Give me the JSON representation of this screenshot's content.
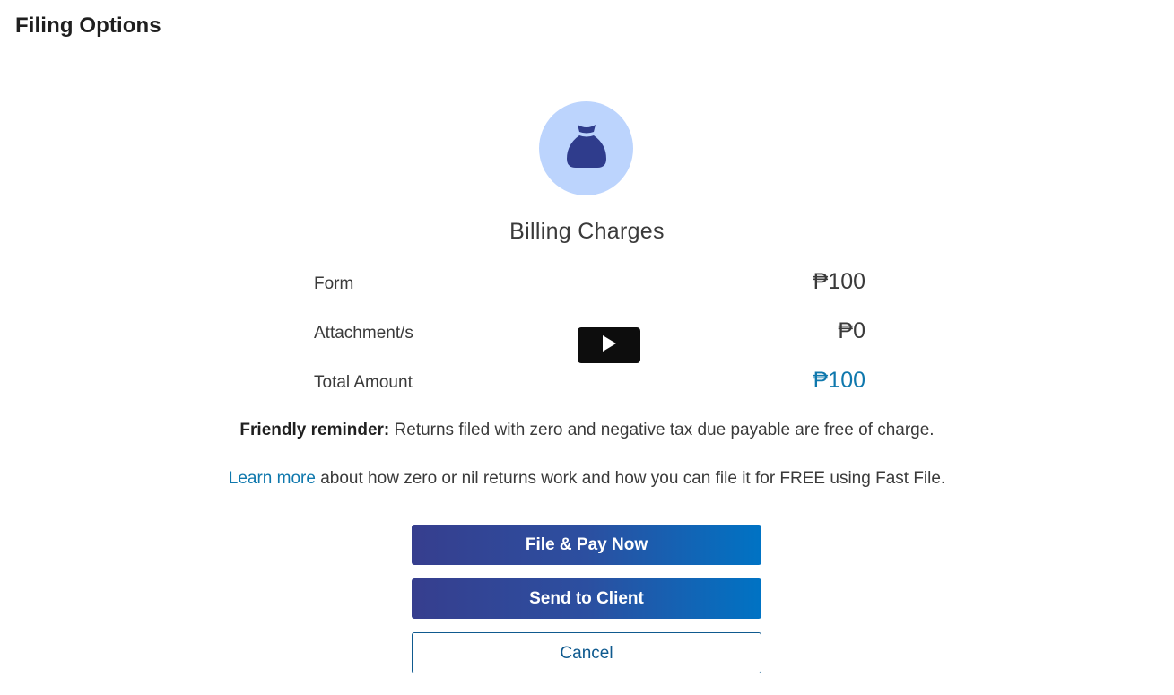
{
  "page": {
    "title": "Filing Options"
  },
  "billing": {
    "icon": "money-bag-icon",
    "title": "Billing Charges",
    "rows": [
      {
        "label": "Form",
        "value": "₱100"
      },
      {
        "label": "Attachment/s",
        "value": "₱0"
      },
      {
        "label": "Total Amount",
        "value": "₱100"
      }
    ]
  },
  "reminder": {
    "bold": "Friendly reminder:",
    "text": " Returns filed with zero and negative tax due payable are free of charge."
  },
  "learn_more": {
    "link": "Learn more",
    "text": " about how zero or nil returns work and how you can file it for FREE using Fast File."
  },
  "actions": {
    "file_pay": "File & Pay Now",
    "send_client": "Send to Client",
    "cancel": "Cancel"
  },
  "video_overlay": {
    "icon": "play-icon"
  },
  "colors": {
    "accent": "#0f78ad",
    "icon_bg": "#bcd4fd",
    "icon_fg": "#2f3c8c",
    "button_gradient_start": "#363e8e",
    "button_gradient_end": "#0073c4"
  }
}
